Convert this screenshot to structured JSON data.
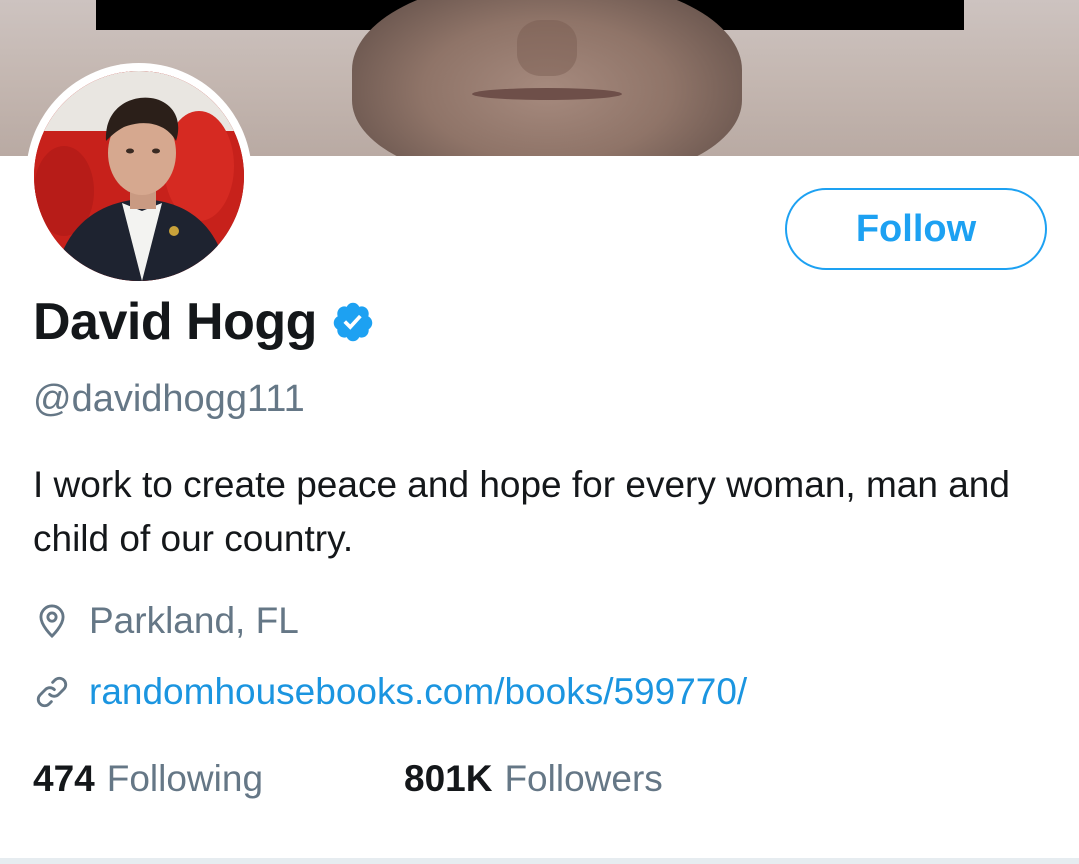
{
  "profile": {
    "display_name": "David Hogg",
    "handle": "@davidhogg111",
    "bio": "I work to create peace and hope for every woman, man and child of our country.",
    "location": "Parkland, FL",
    "website": "randomhousebooks.com/books/599770/",
    "verified": true
  },
  "actions": {
    "follow_label": "Follow"
  },
  "stats": {
    "following_count": "474",
    "following_label": "Following",
    "followers_count": "801K",
    "followers_label": "Followers"
  },
  "icons": {
    "verified": "verified-badge-icon",
    "location": "location-pin-icon",
    "link": "link-icon"
  },
  "colors": {
    "accent": "#1da1f2",
    "link": "#1b95e0",
    "text_primary": "#14171a",
    "text_secondary": "#657786"
  }
}
